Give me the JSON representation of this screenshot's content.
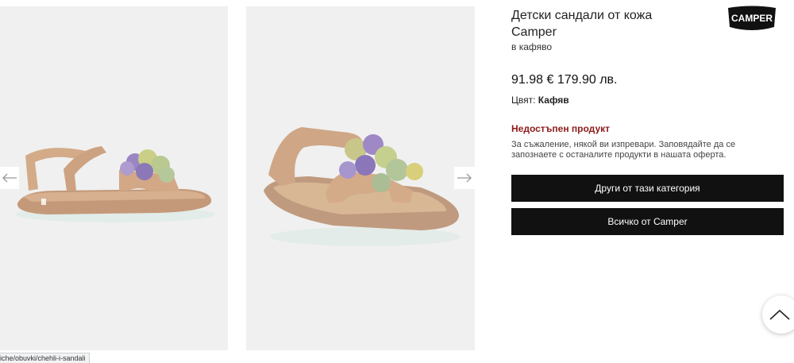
{
  "product": {
    "title": "Детски сандали от кожа Camper",
    "color_variant": "в кафяво",
    "price": "91.98 € 179.90 лв.",
    "color_label": "Цвят:",
    "color_value": "Кафяв",
    "status": "Недостъпен продукт",
    "status_color": "#8e1b1b",
    "message": "За съжаление, някой ви изпревари. Заповядайте да се запознаете с останалите продукти в нашата оферта."
  },
  "brand": {
    "logo_text": "CAMPER"
  },
  "buttons": {
    "category": "Други от тази категория",
    "brand": "Всичко от Camper"
  },
  "gallery": {
    "prev_icon": "arrow-left-icon",
    "next_icon": "arrow-right-icon"
  },
  "status_bar": {
    "url": "iche/obuvki/chehli-i-sandali"
  },
  "scroll_top_icon": "chevron-up-icon"
}
